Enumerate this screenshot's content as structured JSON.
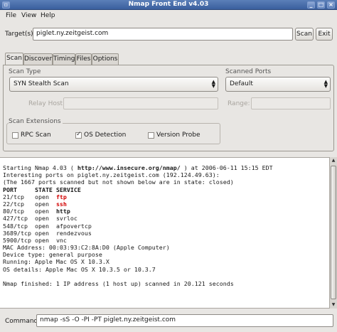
{
  "window": {
    "title": "Nmap Front End v4.03"
  },
  "menu": {
    "file": "File",
    "view": "View",
    "help": "Help"
  },
  "targets": {
    "label": "Target(s):",
    "value": "piglet.ny.zeitgeist.com",
    "scan_button": "Scan",
    "exit_button": "Exit"
  },
  "tabs": [
    "Scan",
    "Discover",
    "Timing",
    "Files",
    "Options"
  ],
  "scan_type": {
    "title": "Scan Type",
    "selected": "SYN Stealth Scan",
    "relay_label": "Relay Host:",
    "relay_value": ""
  },
  "scanned_ports": {
    "title": "Scanned Ports",
    "selected": "Default",
    "range_label": "Range:",
    "range_value": ""
  },
  "scan_extensions": {
    "title": "Scan Extensions",
    "rpc": {
      "label": "RPC Scan",
      "checked": false
    },
    "os": {
      "label": "OS Detection",
      "checked": true
    },
    "version": {
      "label": "Version Probe",
      "checked": false
    }
  },
  "output": {
    "l1a": "Starting Nmap 4.03 ( ",
    "l1b": "http://www.insecure.org/nmap/",
    "l1c": " ) at 2006-06-11 15:15 EDT",
    "l2": "Interesting ports on piglet.ny.zeitgeist.com (192.124.49.63):",
    "l3": "(The 1667 ports scanned but not shown below are in state: closed)",
    "header": "PORT     STATE SERVICE",
    "ports": [
      {
        "port": "21/tcp   open  ",
        "service": "ftp",
        "style": "red"
      },
      {
        "port": "22/tcp   open  ",
        "service": "ssh",
        "style": "red"
      },
      {
        "port": "80/tcp   open  ",
        "service": "http",
        "style": "b"
      },
      {
        "port": "427/tcp  open  ",
        "service": "svrloc",
        "style": ""
      },
      {
        "port": "548/tcp  open  ",
        "service": "afpovertcp",
        "style": ""
      },
      {
        "port": "3689/tcp open  ",
        "service": "rendezvous",
        "style": ""
      },
      {
        "port": "5900/tcp open  ",
        "service": "vnc",
        "style": ""
      }
    ],
    "mac": "MAC Address: 00:03:93:C2:8A:D0 (Apple Computer)",
    "device": "Device type: general purpose",
    "running": "Running: Apple Mac OS X 10.3.X",
    "os": "OS details: Apple Mac OS X 10.3.5 or 10.3.7",
    "finished": "Nmap finished: 1 IP address (1 host up) scanned in 20.121 seconds"
  },
  "command": {
    "label": "Command:",
    "value": "nmap -sS -O -PI -PT piglet.ny.zeitgeist.com"
  },
  "colors": {
    "titlebar": "#3a5f9e",
    "open_highlight": "#d20000",
    "window_bg": "#e8e6e3"
  }
}
